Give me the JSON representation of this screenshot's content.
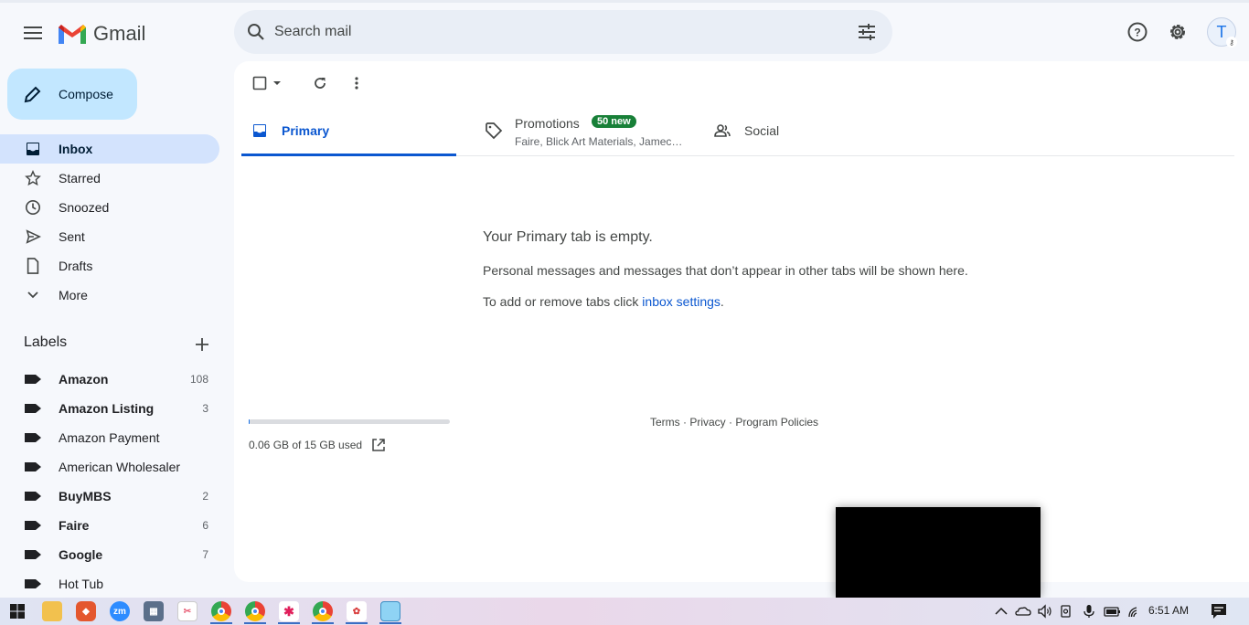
{
  "app": {
    "name": "Gmail"
  },
  "search": {
    "placeholder": "Search mail"
  },
  "compose": {
    "label": "Compose"
  },
  "nav": [
    {
      "label": "Inbox",
      "icon": "inbox-icon",
      "active": true
    },
    {
      "label": "Starred",
      "icon": "star-icon"
    },
    {
      "label": "Snoozed",
      "icon": "clock-icon"
    },
    {
      "label": "Sent",
      "icon": "send-icon"
    },
    {
      "label": "Drafts",
      "icon": "draft-icon"
    },
    {
      "label": "More",
      "icon": "chevron-down-icon"
    }
  ],
  "labels": {
    "title": "Labels",
    "items": [
      {
        "label": "Amazon",
        "count": "108",
        "bold": true
      },
      {
        "label": "Amazon Listing",
        "count": "3",
        "bold": true
      },
      {
        "label": "Amazon Payment",
        "count": "",
        "bold": false
      },
      {
        "label": "American Wholesaler",
        "count": "",
        "bold": false
      },
      {
        "label": "BuyMBS",
        "count": "2",
        "bold": true
      },
      {
        "label": "Faire",
        "count": "6",
        "bold": true
      },
      {
        "label": "Google",
        "count": "7",
        "bold": true
      },
      {
        "label": "Hot Tub",
        "count": "",
        "bold": false
      }
    ]
  },
  "avatar": {
    "initial": "T"
  },
  "tabs": {
    "primary": {
      "label": "Primary"
    },
    "promotions": {
      "label": "Promotions",
      "badge": "50 new",
      "subtitle": "Faire, Blick Art Materials, Jamec…"
    },
    "social": {
      "label": "Social"
    }
  },
  "empty": {
    "title": "Your Primary tab is empty.",
    "body": "Personal messages and messages that don’t appear in other tabs will be shown here.",
    "add_prefix": "To add or remove tabs click ",
    "link": "inbox settings",
    "add_suffix": "."
  },
  "storage": {
    "text": "0.06 GB of 15 GB used",
    "fraction": 0.004
  },
  "footer": {
    "terms": "Terms",
    "sep1": " · ",
    "privacy": "Privacy",
    "sep2": " · ",
    "policies": "Program Policies"
  },
  "taskbar": {
    "time": "6:51 AM"
  },
  "colors": {
    "accent": "#0b57d0",
    "compose_bg": "#c2e7ff",
    "active_nav": "#d3e3fd",
    "badge": "#188038"
  }
}
